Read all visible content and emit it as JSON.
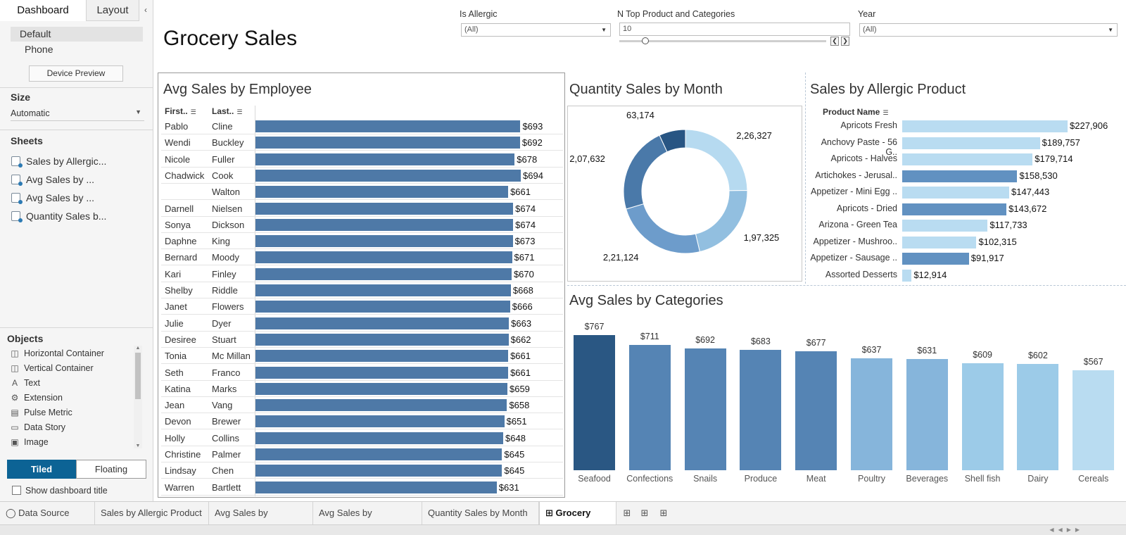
{
  "left_panel": {
    "tabs": [
      "Dashboard",
      "Layout"
    ],
    "devices": [
      "Default",
      "Phone"
    ],
    "device_preview_label": "Device Preview",
    "size_title": "Size",
    "size_value": "Automatic",
    "sheets_title": "Sheets",
    "sheets": [
      "Sales by Allergic...",
      "Avg Sales by ...",
      "Avg Sales by ...",
      "Quantity Sales b..."
    ],
    "objects_title": "Objects",
    "objects": [
      {
        "label": "Horizontal Container",
        "icon": "horizontal-container-icon"
      },
      {
        "label": "Vertical Container",
        "icon": "vertical-container-icon"
      },
      {
        "label": "Text",
        "icon": "text-icon"
      },
      {
        "label": "Extension",
        "icon": "extension-icon"
      },
      {
        "label": "Pulse Metric",
        "icon": "pulse-metric-icon"
      },
      {
        "label": "Data Story",
        "icon": "data-story-icon"
      },
      {
        "label": "Image",
        "icon": "image-icon"
      }
    ],
    "tiled_label": "Tiled",
    "floating_label": "Floating",
    "show_title_label": "Show dashboard title"
  },
  "dashboard": {
    "title": "Grocery Sales",
    "filters": {
      "allergic_label": "Is Allergic",
      "allergic_value": "(All)",
      "topn_label": "N Top Product and Categories",
      "topn_value": "10",
      "topn_slider_fraction": 0.1,
      "year_label": "Year",
      "year_value": "(All)"
    },
    "colors": {
      "bar_blue": "#4e79a7",
      "accent": "#0c6395"
    }
  },
  "chart_data": [
    {
      "type": "bar",
      "title": "Avg Sales by Employee",
      "column_headers": [
        "First..",
        "Last.."
      ],
      "rows": [
        {
          "first": "Pablo",
          "last": "Cline",
          "value": 693,
          "label": "$693"
        },
        {
          "first": "Wendi",
          "last": "Buckley",
          "value": 692,
          "label": "$692"
        },
        {
          "first": "Nicole",
          "last": "Fuller",
          "value": 678,
          "label": "$678"
        },
        {
          "first": "Chadwick",
          "last": "Cook",
          "value": 694,
          "label": "$694"
        },
        {
          "first": "",
          "last": "Walton",
          "value": 661,
          "label": "$661"
        },
        {
          "first": "Darnell",
          "last": "Nielsen",
          "value": 674,
          "label": "$674"
        },
        {
          "first": "Sonya",
          "last": "Dickson",
          "value": 674,
          "label": "$674"
        },
        {
          "first": "Daphne",
          "last": "King",
          "value": 673,
          "label": "$673"
        },
        {
          "first": "Bernard",
          "last": "Moody",
          "value": 671,
          "label": "$671"
        },
        {
          "first": "Kari",
          "last": "Finley",
          "value": 670,
          "label": "$670"
        },
        {
          "first": "Shelby",
          "last": "Riddle",
          "value": 668,
          "label": "$668"
        },
        {
          "first": "Janet",
          "last": "Flowers",
          "value": 666,
          "label": "$666"
        },
        {
          "first": "Julie",
          "last": "Dyer",
          "value": 663,
          "label": "$663"
        },
        {
          "first": "Desiree",
          "last": "Stuart",
          "value": 662,
          "label": "$662"
        },
        {
          "first": "Tonia",
          "last": "Mc Millan",
          "value": 661,
          "label": "$661"
        },
        {
          "first": "Seth",
          "last": "Franco",
          "value": 661,
          "label": "$661"
        },
        {
          "first": "Katina",
          "last": "Marks",
          "value": 659,
          "label": "$659"
        },
        {
          "first": "Jean",
          "last": "Vang",
          "value": 658,
          "label": "$658"
        },
        {
          "first": "Devon",
          "last": "Brewer",
          "value": 651,
          "label": "$651"
        },
        {
          "first": "Holly",
          "last": "Collins",
          "value": 648,
          "label": "$648"
        },
        {
          "first": "Christine",
          "last": "Palmer",
          "value": 645,
          "label": "$645"
        },
        {
          "first": "Lindsay",
          "last": "Chen",
          "value": 645,
          "label": "$645"
        },
        {
          "first": "Warren",
          "last": "Bartlett",
          "value": 631,
          "label": "$631"
        }
      ]
    },
    {
      "type": "pie",
      "title": "Quantity Sales by Month",
      "slices": [
        {
          "label": "2,26,327",
          "value": 226327,
          "color": "#b6daf0"
        },
        {
          "label": "1,97,325",
          "value": 197325,
          "color": "#92bfe0"
        },
        {
          "label": "2,21,124",
          "value": 221124,
          "color": "#6d9ccb"
        },
        {
          "label": "2,07,632",
          "value": 207632,
          "color": "#4a79a9"
        },
        {
          "label": "63,174",
          "value": 63174,
          "color": "#285583"
        }
      ]
    },
    {
      "type": "bar",
      "title": "Sales by Allergic Product",
      "column_header": "Product Name",
      "rows": [
        {
          "name": "Apricots Fresh",
          "value": 227906,
          "label": "$227,906",
          "color": "#b9dcf1"
        },
        {
          "name": "Anchovy Paste - 56 G..",
          "value": 189757,
          "label": "$189,757",
          "color": "#b9dcf1"
        },
        {
          "name": "Apricots - Halves",
          "value": 179714,
          "label": "$179,714",
          "color": "#b9dcf1"
        },
        {
          "name": "Artichokes - Jerusal..",
          "value": 158530,
          "label": "$158,530",
          "color": "#6191c1"
        },
        {
          "name": "Appetizer - Mini Egg ..",
          "value": 147443,
          "label": "$147,443",
          "color": "#b9dcf1"
        },
        {
          "name": "Apricots - Dried",
          "value": 143672,
          "label": "$143,672",
          "color": "#6191c1"
        },
        {
          "name": "Arizona - Green Tea",
          "value": 117733,
          "label": "$117,733",
          "color": "#b9dcf1"
        },
        {
          "name": "Appetizer - Mushroo..",
          "value": 102315,
          "label": "$102,315",
          "color": "#b9dcf1"
        },
        {
          "name": "Appetizer - Sausage ..",
          "value": 91917,
          "label": "$91,917",
          "color": "#6191c1"
        },
        {
          "name": "Assorted Desserts",
          "value": 12914,
          "label": "$12,914",
          "color": "#b9dcf1"
        }
      ]
    },
    {
      "type": "bar",
      "title": "Avg Sales by Categories",
      "categories": [
        "Seafood",
        "Confections",
        "Snails",
        "Produce",
        "Meat",
        "Poultry",
        "Beverages",
        "Shell fish",
        "Dairy",
        "Cereals"
      ],
      "values": [
        767,
        711,
        692,
        683,
        677,
        637,
        631,
        609,
        602,
        567
      ],
      "labels": [
        "$767",
        "$711",
        "$692",
        "$683",
        "$677",
        "$637",
        "$631",
        "$609",
        "$602",
        "$567"
      ],
      "colors": [
        "#2a5783",
        "#5584b4",
        "#5584b4",
        "#5584b4",
        "#5584b4",
        "#86b5db",
        "#86b5db",
        "#9ccbe8",
        "#9ccbe8",
        "#b9dcf1"
      ]
    }
  ],
  "bottom_tabs": {
    "data_source": "Data Source",
    "sheets": [
      "Sales by Allergic Product",
      "Avg Sales by Employee",
      "Avg Sales by Categories",
      "Quantity Sales by Month"
    ],
    "active": "Grocery Sales"
  }
}
